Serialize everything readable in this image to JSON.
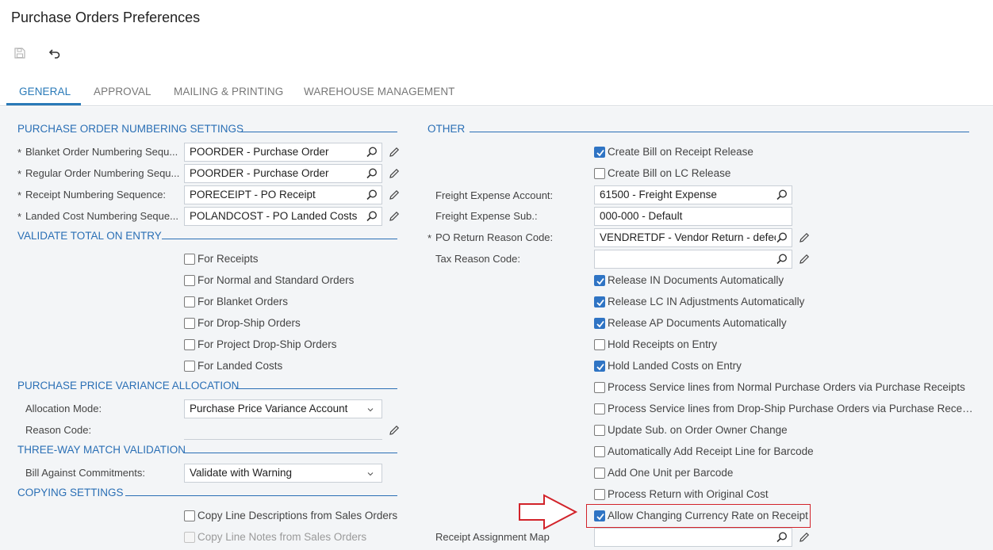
{
  "page": {
    "title": "Purchase Orders Preferences"
  },
  "toolbar": {
    "save_icon": "save-icon",
    "undo_icon": "undo-icon"
  },
  "tabs": [
    {
      "label": "GENERAL",
      "active": true
    },
    {
      "label": "APPROVAL"
    },
    {
      "label": "MAILING & PRINTING"
    },
    {
      "label": "WAREHOUSE MANAGEMENT"
    }
  ],
  "colors": {
    "accent": "#2a7ab8",
    "checkbox_checked": "#2f74c4",
    "highlight": "#d2232a"
  },
  "numbering": {
    "header": "PURCHASE ORDER NUMBERING SETTINGS",
    "blanket": {
      "label": "Blanket Order Numbering Sequ...",
      "value": "POORDER - Purchase Order"
    },
    "regular": {
      "label": "Regular Order Numbering Sequ...",
      "value": "POORDER - Purchase Order"
    },
    "receipt": {
      "label": "Receipt Numbering Sequence:",
      "value": "PORECEIPT - PO Receipt"
    },
    "landed": {
      "label": "Landed Cost Numbering Seque...",
      "value": "POLANDCOST - PO Landed Costs"
    }
  },
  "validate": {
    "header": "VALIDATE TOTAL ON ENTRY",
    "items": [
      "For Receipts",
      "For Normal and Standard Orders",
      "For Blanket Orders",
      "For Drop-Ship Orders",
      "For Project Drop-Ship Orders",
      "For Landed Costs"
    ]
  },
  "ppv": {
    "header": "PURCHASE PRICE VARIANCE ALLOCATION",
    "allocation_label": "Allocation Mode:",
    "allocation_value": "Purchase Price Variance Account",
    "reason_label": "Reason Code:",
    "reason_value": ""
  },
  "threeway": {
    "header": "THREE-WAY MATCH VALIDATION",
    "bill_label": "Bill Against Commitments:",
    "bill_value": "Validate with Warning"
  },
  "copying": {
    "header": "COPYING SETTINGS",
    "items": [
      {
        "label": "Copy Line Descriptions from Sales Orders",
        "checked": false
      },
      {
        "label": "Copy Line Notes from Sales Orders",
        "checked": false,
        "disabled": true
      }
    ]
  },
  "other": {
    "header": "OTHER",
    "create_bill": {
      "label": "Create Bill on Receipt Release",
      "checked": true
    },
    "create_bill_lc": {
      "label": "Create Bill on LC Release",
      "checked": false
    },
    "freight_account": {
      "label": "Freight Expense Account:",
      "value": "61500 - Freight Expense"
    },
    "freight_sub": {
      "label": "Freight Expense Sub.:",
      "value": "000-000 - Default"
    },
    "po_return": {
      "label": "PO Return Reason Code:",
      "value": "VENDRETDF - Vendor Return - defect"
    },
    "tax_reason": {
      "label": "Tax Reason Code:",
      "value": ""
    },
    "checks": [
      {
        "label": "Release IN Documents Automatically",
        "checked": true
      },
      {
        "label": "Release LC IN Adjustments Automatically",
        "checked": true
      },
      {
        "label": "Release AP Documents Automatically",
        "checked": true
      },
      {
        "label": "Hold Receipts on Entry",
        "checked": false
      },
      {
        "label": "Hold Landed Costs on Entry",
        "checked": true
      },
      {
        "label": "Process Service lines from Normal Purchase Orders via Purchase Receipts",
        "checked": false
      },
      {
        "label": "Process Service lines from Drop-Ship Purchase Orders via Purchase Rece…",
        "checked": false
      },
      {
        "label": "Update Sub. on Order Owner Change",
        "checked": false
      },
      {
        "label": "Automatically Add Receipt Line for Barcode",
        "checked": false
      },
      {
        "label": "Add One Unit per Barcode",
        "checked": false
      },
      {
        "label": "Process Return with Original Cost",
        "checked": false
      },
      {
        "label": "Allow Changing Currency Rate on Receipt",
        "checked": true
      }
    ],
    "receipt_assignment": {
      "label": "Receipt Assignment Map",
      "value": ""
    }
  }
}
